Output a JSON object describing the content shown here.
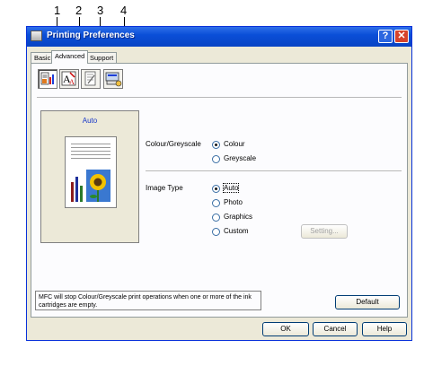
{
  "callouts": [
    "1",
    "2",
    "3",
    "4"
  ],
  "window": {
    "title": "Printing Preferences",
    "help_button": "?",
    "close_button": "✕"
  },
  "tabs": [
    {
      "label": "Basic",
      "active": false
    },
    {
      "label": "Advanced",
      "active": true
    },
    {
      "label": "Support",
      "active": false
    }
  ],
  "toolbar_icons": [
    "print-quality-icon",
    "watermark-icon",
    "page-setting-icon",
    "device-options-icon"
  ],
  "preview": {
    "label": "Auto"
  },
  "colour_greyscale": {
    "label": "Colour/Greyscale",
    "options": [
      "Colour",
      "Greyscale"
    ],
    "selected": "Colour"
  },
  "image_type": {
    "label": "Image Type",
    "options": [
      "Auto",
      "Photo",
      "Graphics",
      "Custom"
    ],
    "selected": "Auto"
  },
  "buttons": {
    "setting": "Setting...",
    "default": "Default",
    "ok": "OK",
    "cancel": "Cancel",
    "help": "Help"
  },
  "info_message": "MFC will stop Colour/Greyscale print operations when one or more of the ink cartridges are empty."
}
